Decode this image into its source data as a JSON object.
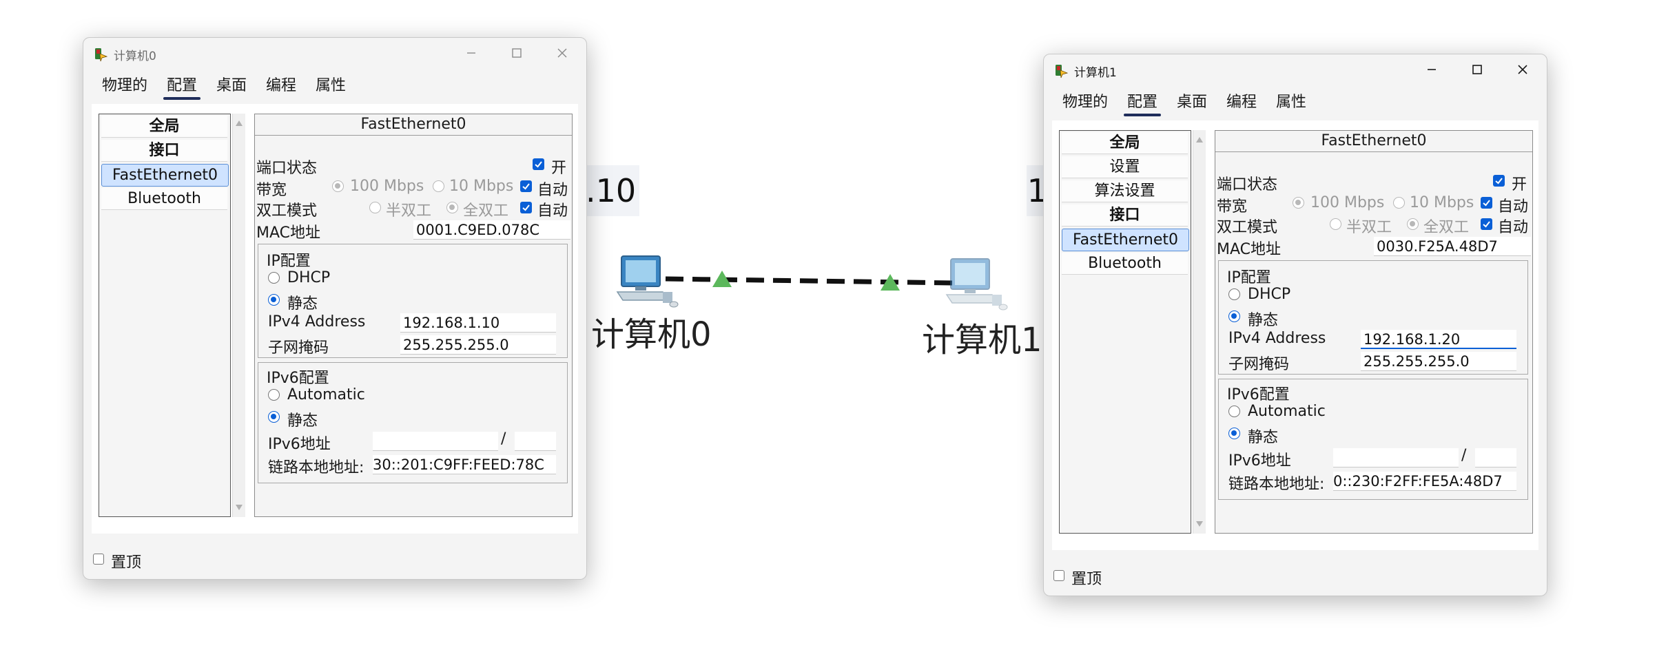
{
  "canvas": {
    "label_left_behind": ".10",
    "label_right_behind": "1",
    "node0_label": "计算机0",
    "node1_label": "计算机1"
  },
  "win0": {
    "title": "计算机0",
    "tabs": [
      "物理的",
      "配置",
      "桌面",
      "编程",
      "属性"
    ],
    "selected_tab": "配置",
    "nav_items": [
      "全局",
      "接口",
      "FastEthernet0",
      "Bluetooth"
    ],
    "selected_nav": "FastEthernet0",
    "panel_title": "FastEthernet0",
    "port_status_label": "端口状态",
    "port_on_label": "开",
    "bandwidth_label": "带宽",
    "bw_100": "100 Mbps",
    "bw_10": "10 Mbps",
    "auto_label": "自动",
    "duplex_label": "双工模式",
    "half_duplex": "半双工",
    "full_duplex": "全双工",
    "mac_label": "MAC地址",
    "mac_value": "0001.C9ED.078C",
    "ip_config_label": "IP配置",
    "dhcp_label": "DHCP",
    "static_label": "静态",
    "ipv4_label": "IPv4 Address",
    "ipv4_value": "192.168.1.10",
    "mask_label": "子网掩码",
    "mask_value": "255.255.255.0",
    "ipv6_config_label": "IPv6配置",
    "automatic_label": "Automatic",
    "ipv6_static_label": "静态",
    "ipv6_addr_label": "IPv6地址",
    "ipv6_slash": "/",
    "link_local_label": "链路本地地址:",
    "link_local_value": "30::201:C9FF:FEED:78C",
    "on_top_label": "置顶"
  },
  "win1": {
    "title": "计算机1",
    "tabs": [
      "物理的",
      "配置",
      "桌面",
      "编程",
      "属性"
    ],
    "selected_tab": "配置",
    "nav_items": [
      "全局",
      "设置",
      "算法设置",
      "接口",
      "FastEthernet0",
      "Bluetooth"
    ],
    "selected_nav": "FastEthernet0",
    "panel_title": "FastEthernet0",
    "port_status_label": "端口状态",
    "port_on_label": "开",
    "bandwidth_label": "带宽",
    "bw_100": "100 Mbps",
    "bw_10": "10 Mbps",
    "auto_label": "自动",
    "duplex_label": "双工模式",
    "half_duplex": "半双工",
    "full_duplex": "全双工",
    "mac_label": "MAC地址",
    "mac_value": "0030.F25A.48D7",
    "ip_config_label": "IP配置",
    "dhcp_label": "DHCP",
    "static_label": "静态",
    "ipv4_label": "IPv4 Address",
    "ipv4_value": "192.168.1.20",
    "mask_label": "子网掩码",
    "mask_value": "255.255.255.0",
    "ipv6_config_label": "IPv6配置",
    "automatic_label": "Automatic",
    "ipv6_static_label": "静态",
    "ipv6_addr_label": "IPv6地址",
    "ipv6_slash": "/",
    "link_local_label": "链路本地地址:",
    "link_local_value": "0::230:F2FF:FE5A:48D7",
    "on_top_label": "置顶"
  },
  "colors": {
    "accent": "#0a5fd6",
    "link_green": "#5cb85c",
    "tab_underline": "#1f2d5a",
    "selected_nav_bg": "#cfe3ff"
  },
  "icons": [
    "packet-tracer-app-icon",
    "minimize-icon",
    "maximize-icon",
    "close-icon",
    "pc-icon",
    "checkbox-checked-icon",
    "radio-icon",
    "scroll-up-arrow-icon",
    "scroll-down-arrow-icon"
  ]
}
